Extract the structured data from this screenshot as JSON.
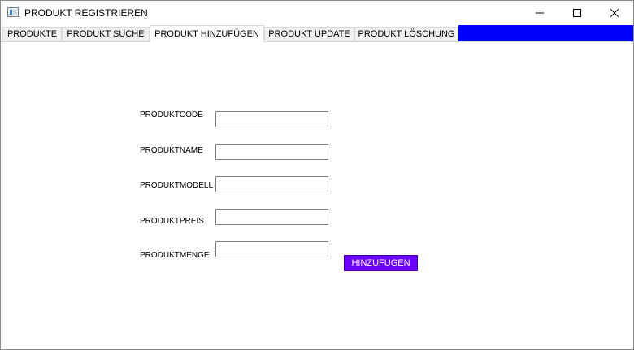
{
  "window": {
    "title": "PRODUKT REGISTRIEREN"
  },
  "tabs": [
    {
      "label": "PRODUKTE"
    },
    {
      "label": "PRODUKT SUCHE"
    },
    {
      "label": "PRODUKT HINZUFÜGEN",
      "active": true
    },
    {
      "label": "PRODUKT UPDATE"
    },
    {
      "label": "PRODUKT LÖSCHUNG"
    }
  ],
  "form": {
    "fields": [
      {
        "label": "PRODUKTCODE",
        "value": ""
      },
      {
        "label": "PRODUKTNAME",
        "value": ""
      },
      {
        "label": "PRODUKTMODELL",
        "value": ""
      },
      {
        "label": "PRODUKTPREIS",
        "value": ""
      },
      {
        "label": "PRODUKTMENGE",
        "value": ""
      }
    ],
    "submit_label": "HINZUFUGEN"
  },
  "colors": {
    "tab_strip_fill": "#0000ff",
    "submit_button_bg": "#6a00ff",
    "submit_button_text": "#ffffff"
  },
  "icons": {
    "app": "app-window-icon",
    "minimize": "minimize-icon",
    "maximize": "maximize-icon",
    "close": "close-icon"
  }
}
